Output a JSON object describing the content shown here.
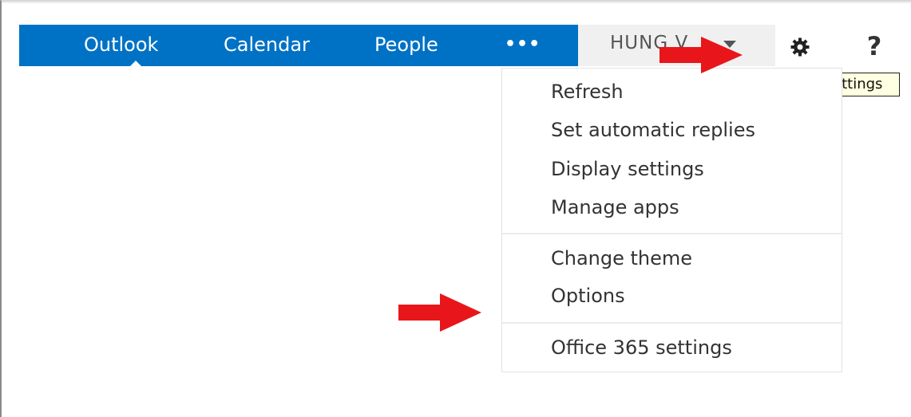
{
  "nav": {
    "items": [
      {
        "label": "Outlook"
      },
      {
        "label": "Calendar"
      },
      {
        "label": "People"
      },
      {
        "label": "•••"
      }
    ],
    "active": "Outlook"
  },
  "user": {
    "name": "HUNG V"
  },
  "toolbar": {
    "settings_icon": "gear-icon",
    "help_label": "?"
  },
  "tooltip": {
    "text": "Settings"
  },
  "settings_menu": {
    "groups": [
      {
        "items": [
          {
            "label": "Refresh"
          },
          {
            "label": "Set automatic replies"
          },
          {
            "label": "Display settings"
          },
          {
            "label": "Manage apps"
          }
        ]
      },
      {
        "items": [
          {
            "label": "Change theme"
          },
          {
            "label": "Options"
          }
        ]
      },
      {
        "items": [
          {
            "label": "Office 365 settings"
          }
        ]
      }
    ]
  },
  "colors": {
    "nav_bar": "#0072c6",
    "user_box": "#f0f0f0",
    "annotation_arrow": "#e8161b",
    "tooltip_bg": "#ffffe1"
  }
}
